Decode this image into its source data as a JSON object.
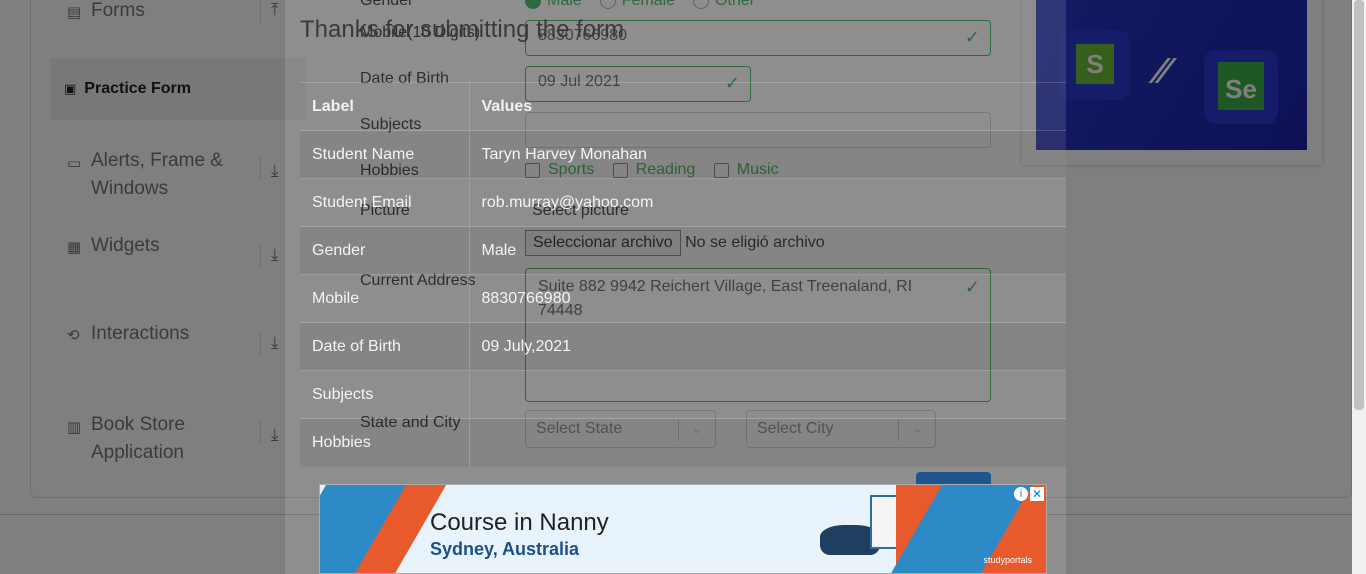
{
  "sidebar": {
    "items": [
      {
        "label": "Forms",
        "icon": "document-icon"
      },
      {
        "label": "Practice Form",
        "icon": "html-icon"
      },
      {
        "label": "Alerts, Frame & Windows",
        "line1": "Alerts, Frame &",
        "line2": "Windows",
        "icon": "window-icon"
      },
      {
        "label": "Widgets",
        "icon": "widgets-icon"
      },
      {
        "label": "Interactions",
        "icon": "interactions-icon"
      },
      {
        "label": "Book Store Application",
        "line1": "Book Store",
        "line2": "Application",
        "icon": "books-icon"
      }
    ]
  },
  "form": {
    "gender_label": "Gender",
    "gender_options": [
      "Male",
      "Female",
      "Other"
    ],
    "mobile_label": "Mobile(10 Digits)",
    "mobile_value": "8830766980",
    "dob_label": "Date of Birth",
    "dob_value": "09 Jul 2021",
    "subjects_label": "Subjects",
    "hobbies_label": "Hobbies",
    "hobbies_options": [
      "Sports",
      "Reading",
      "Music"
    ],
    "picture_label": "Picture",
    "picture_hint": "Select picture",
    "file_button": "Seleccionar archivo",
    "file_status": "No se eligió archivo",
    "address_label": "Current Address",
    "address_value": "Suite 882 9942 Reichert Village, East Treenaland, RI 74448",
    "state_city_label": "State and City",
    "state_placeholder": "Select State",
    "city_placeholder": "Select City"
  },
  "modal": {
    "title": "Thanks for submitting the form",
    "header_label": "Label",
    "header_values": "Values",
    "rows": [
      {
        "label": "Student Name",
        "value": "Taryn Harvey Monahan"
      },
      {
        "label": "Student Email",
        "value": "rob.murray@yahoo.com"
      },
      {
        "label": "Gender",
        "value": "Male"
      },
      {
        "label": "Mobile",
        "value": "8830766980"
      },
      {
        "label": "Date of Birth",
        "value": "09 July,2021"
      },
      {
        "label": "Subjects",
        "value": ""
      },
      {
        "label": "Hobbies",
        "value": ""
      }
    ]
  },
  "ad": {
    "title": "Course in Nanny",
    "subtitle": "Sydney, Australia",
    "brand": "studyportals"
  },
  "colors": {
    "accent_green": "#28a745",
    "sidebar": "#ffffff",
    "overlay": "rgba(0,0,0,0.5)"
  }
}
